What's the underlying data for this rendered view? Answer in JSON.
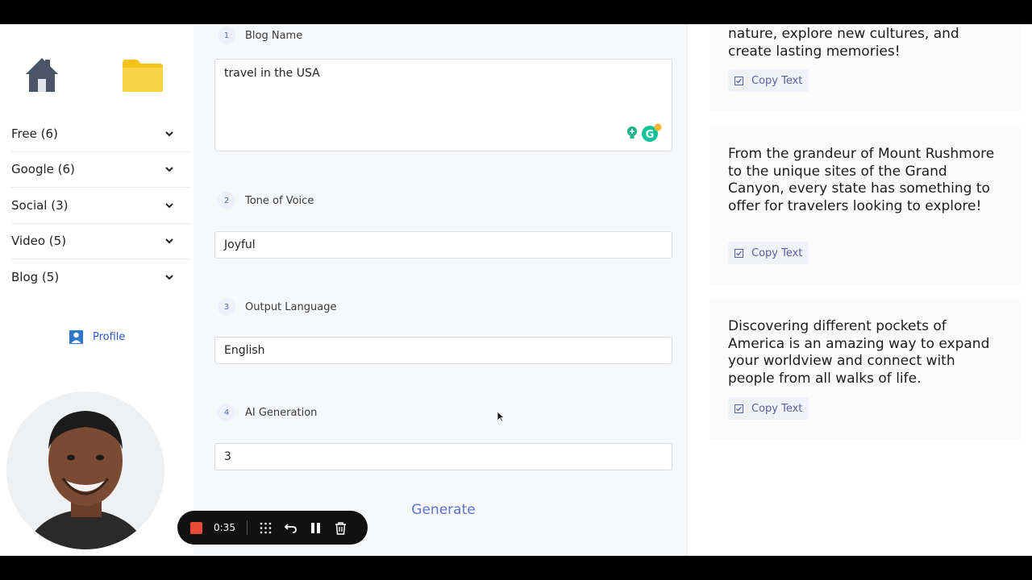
{
  "sidebar": {
    "menu": [
      {
        "label": "Free (6)"
      },
      {
        "label": "Google (6)"
      },
      {
        "label": "Social (3)"
      },
      {
        "label": "Video (5)"
      },
      {
        "label": "Blog (5)"
      }
    ],
    "profile_label": "Profile"
  },
  "form": {
    "fields": [
      {
        "step": "1",
        "label": "Blog Name",
        "value": "travel in the USA"
      },
      {
        "step": "2",
        "label": "Tone of Voice",
        "value": "Joyful"
      },
      {
        "step": "3",
        "label": "Output Language",
        "value": "English"
      },
      {
        "step": "4",
        "label": "AI Generation",
        "value": "3"
      }
    ],
    "generate_label": "Generate"
  },
  "recorder": {
    "time": "0:35"
  },
  "results": {
    "cards": [
      {
        "text": "nature, explore new cultures, and create lasting memories!",
        "copy_label": "Copy Text"
      },
      {
        "text": "From the grandeur of Mount Rushmore to the unique sites of the Grand Canyon, every state has something to offer for travelers looking to explore!",
        "copy_label": "Copy Text"
      },
      {
        "text": "Discovering different pockets of America is an amazing way to expand your worldview and connect with people from all walks of life.",
        "copy_label": "Copy Text"
      }
    ]
  },
  "colors": {
    "accent": "#5d74c9",
    "record": "#e84a3a",
    "folder": "#f7d445",
    "home": "#4a5568"
  }
}
